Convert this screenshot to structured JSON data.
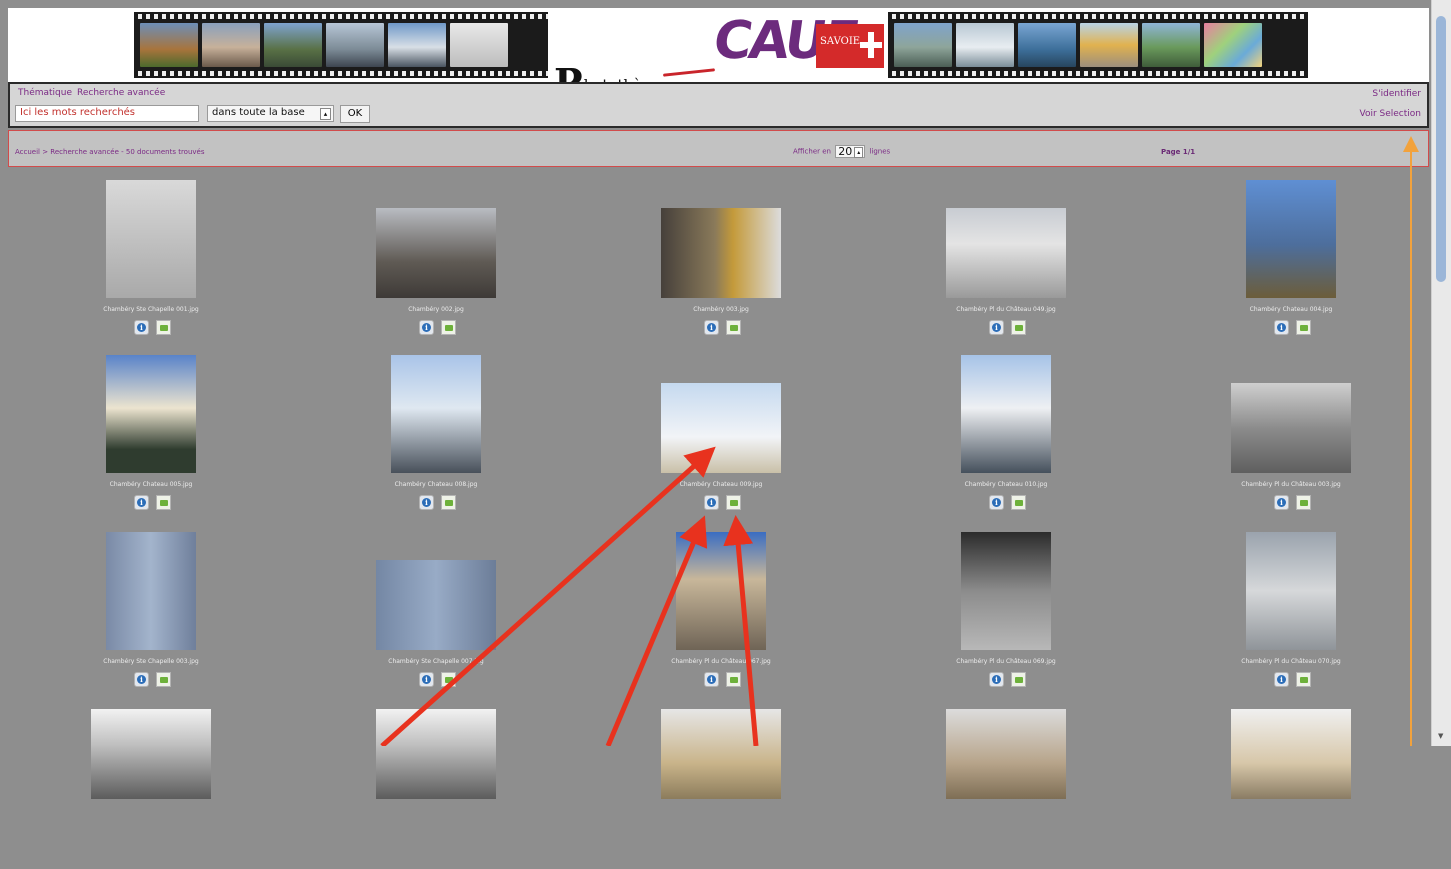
{
  "header": {
    "logo_text": "Photothèque",
    "logo_initial": "P",
    "logo_rest": "hotothèque",
    "brand_name": "CAUE",
    "brand_region": "SAVOIE"
  },
  "nav": {
    "tabs": [
      "Thématique",
      "Recherche avancée"
    ],
    "login_label": "S'identifier",
    "selection_label": "Voir Selection"
  },
  "search": {
    "query": "Ici les mots recherchés",
    "scope": "dans toute la base",
    "ok_label": "OK"
  },
  "results_bar": {
    "breadcrumb": "Accueil > Recherche avancée - 50 documents trouvés",
    "per_page_prefix": "Afficher en",
    "per_page_value": "20",
    "per_page_suffix": "lignes",
    "page_label": "Page 1/1"
  },
  "results": [
    {
      "caption": "Chambéry Ste Chapelle 001.jpg"
    },
    {
      "caption": "Chambéry 002.jpg"
    },
    {
      "caption": "Chambéry 003.jpg"
    },
    {
      "caption": "Chambéry Pl du Château 049.jpg"
    },
    {
      "caption": "Chambéry Chateau 004.jpg"
    },
    {
      "caption": "Chambéry Chateau 005.jpg"
    },
    {
      "caption": "Chambéry Chateau 008.jpg"
    },
    {
      "caption": "Chambéry Chateau 009.jpg"
    },
    {
      "caption": "Chambéry Chateau 010.jpg"
    },
    {
      "caption": "Chambéry Pl du Château 003.jpg"
    },
    {
      "caption": "Chambéry Ste Chapelle 003.jpg"
    },
    {
      "caption": "Chambéry Ste Chapelle 007.jpg"
    },
    {
      "caption": "Chambéry Pl du Château 067.jpg"
    },
    {
      "caption": "Chambéry Pl du Château 069.jpg"
    },
    {
      "caption": "Chambéry Pl du Château 070.jpg"
    },
    {
      "caption": ""
    },
    {
      "caption": ""
    },
    {
      "caption": ""
    },
    {
      "caption": ""
    },
    {
      "caption": ""
    }
  ],
  "colors": {
    "accent_purple": "#7b2a85",
    "annotation_red": "#e8321e",
    "annotation_orange": "#f2a23c",
    "page_background": "#8e8e8e"
  }
}
